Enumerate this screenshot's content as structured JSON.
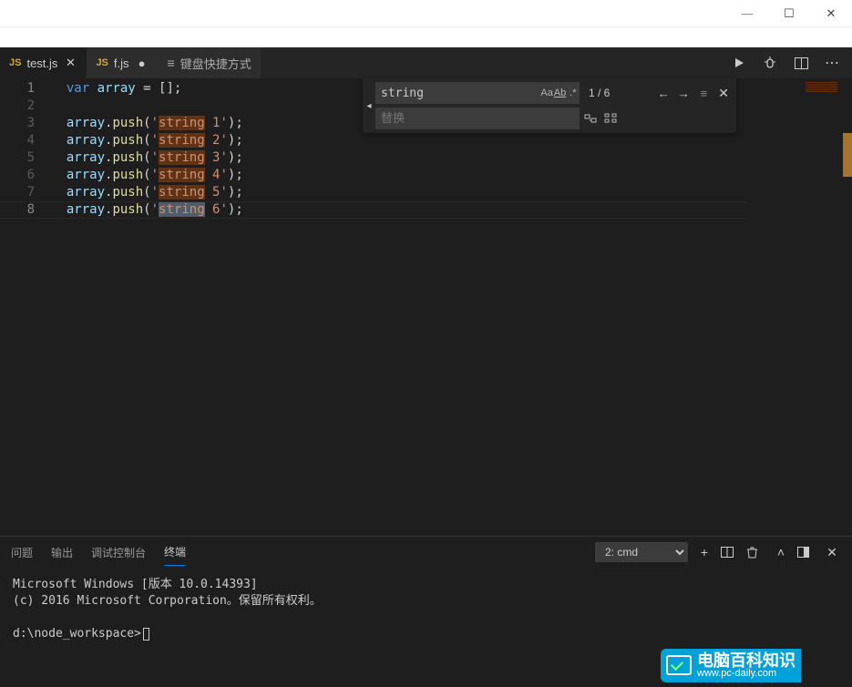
{
  "titlebar": {
    "minimize": "—",
    "maximize": "☐",
    "close": "✕"
  },
  "tabs": [
    {
      "icon": "JS",
      "label": "test.js",
      "close": "✕"
    },
    {
      "icon": "JS",
      "label": "f.js",
      "dot": "●"
    },
    {
      "kb_icon": "≡",
      "label": "键盘快捷方式"
    }
  ],
  "toolbar": {
    "run": "▶",
    "debug": "🐞",
    "split": "⫿⫿",
    "more": "⋯"
  },
  "gutter": [
    "1",
    "2",
    "3",
    "4",
    "5",
    "6",
    "7",
    "8"
  ],
  "code": {
    "var": "var",
    "array": "array",
    "eq": " = [];",
    "push": "push",
    "strings": [
      "string 1",
      "string 2",
      "string 3",
      "string 4",
      "string 5",
      "string 6"
    ]
  },
  "search": {
    "toggle": "◂",
    "find_value": "string",
    "case": "Aa",
    "word": "Ab|",
    "regex": ".*",
    "count": "1 / 6",
    "prev": "←",
    "next": "→",
    "selection": "≡",
    "close": "✕",
    "replace_placeholder": "替换",
    "replace_one": "⇄",
    "replace_all": "⇉"
  },
  "panel": {
    "tabs": {
      "problems": "问题",
      "output": "输出",
      "debug": "调试控制台",
      "terminal": "终端"
    },
    "select": "2: cmd",
    "icons": {
      "add": "+",
      "split": "⫿⫿",
      "trash": "🗑",
      "up": "˄",
      "maximize": "◨",
      "close": "✕"
    }
  },
  "terminal": {
    "l1": "Microsoft Windows [版本 10.0.14393]",
    "l2": "(c) 2016 Microsoft Corporation。保留所有权利。",
    "l3": "d:\\node_workspace>"
  },
  "watermark": {
    "big": "电脑百科知识",
    "small": "www.pc-daily.com"
  }
}
